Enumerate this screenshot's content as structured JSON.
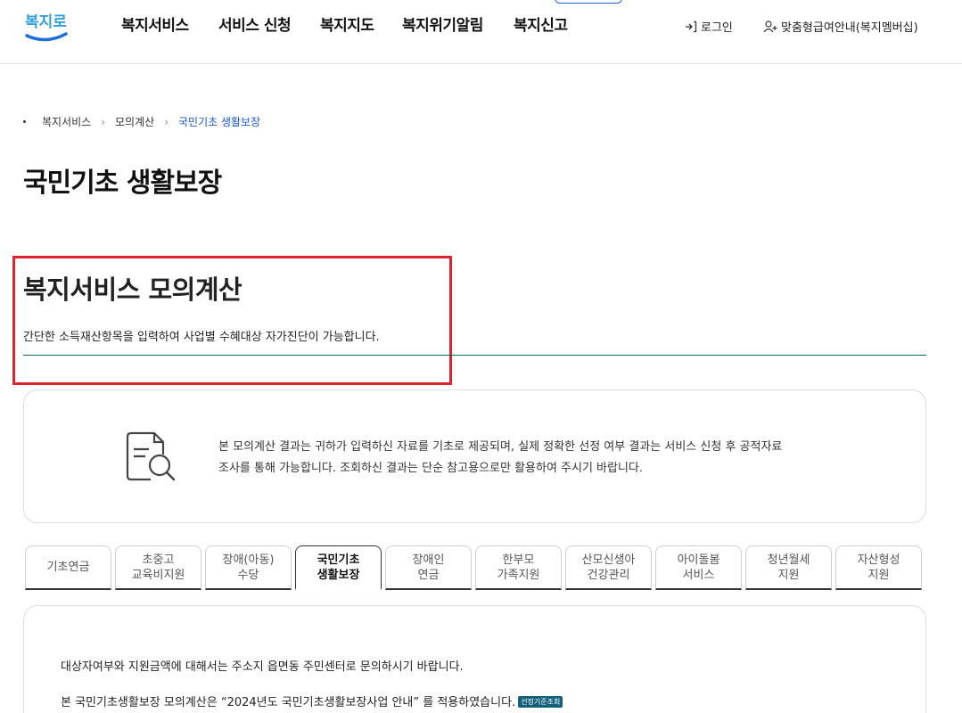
{
  "header": {
    "logo_text": "복지로",
    "nav": [
      "복지서비스",
      "서비스 신청",
      "복지지도",
      "복지위기알림",
      "복지신고"
    ],
    "login_label": "로그인",
    "membership_label": "맞춤형급여안내(복지멤버십)",
    "icons": {
      "login": "login-arrow-icon",
      "membership": "user-plus-icon"
    }
  },
  "breadcrumb": [
    "복지서비스",
    "모의계산",
    "국민기초 생활보장"
  ],
  "page_title": "국민기초 생활보장",
  "section": {
    "title": "복지서비스 모의계산",
    "description": "간단한 소득재산항목을 입력하여 사업별 수혜대상 자가진단이 가능합니다."
  },
  "notice": {
    "icon": "document-search-icon",
    "line1": "본 모의계산 결과는 귀하가 입력하신 자료를 기초로 제공되며, 실제 정확한 선정 여부 결과는 서비스 신청 후 공적자료",
    "line2": "조사를 통해 가능합니다. 조회하신 결과는 단순 참고용으로만 활용하여 주시기 바랍니다."
  },
  "tabs": [
    {
      "label": "기초연금",
      "active": false
    },
    {
      "label": "초중고\n교육비지원",
      "active": false
    },
    {
      "label": "장애(아동)\n수당",
      "active": false
    },
    {
      "label": "국민기초\n생활보장",
      "active": true
    },
    {
      "label": "장애인\n연금",
      "active": false
    },
    {
      "label": "한부모\n가족지원",
      "active": false
    },
    {
      "label": "산모신생아\n건강관리",
      "active": false
    },
    {
      "label": "아이돌봄\n서비스",
      "active": false
    },
    {
      "label": "청년월세\n지원",
      "active": false
    },
    {
      "label": "자산형성\n지원",
      "active": false
    }
  ],
  "info": {
    "line1": "대상자여부와 지원금액에 대해서는 주소지 읍면동 주민센터로 문의하시기 바랍니다.",
    "line2": "본 국민기초생활보장 모의계산은 “2024년도 국민기초생활보장사업 안내” 를 적용하였습니다.",
    "badge": "선정기준조회"
  },
  "colors": {
    "accent": "#1a56c8",
    "highlight_border": "#e0202a",
    "divider": "#0e6b6b",
    "badge": "#11607a"
  }
}
